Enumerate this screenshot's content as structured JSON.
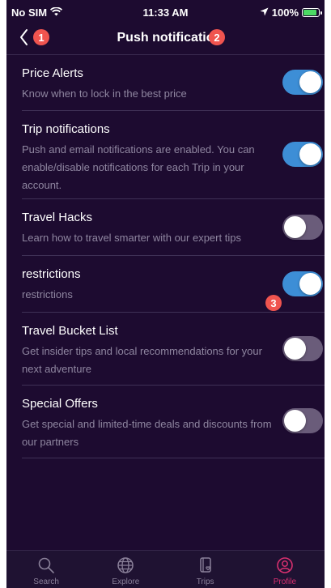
{
  "status_bar": {
    "carrier": "No SIM",
    "time": "11:33 AM",
    "battery": "100%"
  },
  "header": {
    "title": "Push notificatio",
    "back_badge": "1",
    "title_badge": "2"
  },
  "settings": [
    {
      "title": "Price Alerts",
      "description": "Know when to lock in the best price",
      "enabled": true
    },
    {
      "title": "Trip notifications",
      "description": "Push and email notifications are enabled. You can enable/disable notifications for each Trip in your account.",
      "enabled": true
    },
    {
      "title": "Travel Hacks",
      "description": "Learn how to travel smarter with our expert tips",
      "enabled": false
    },
    {
      "title": "restrictions",
      "description": "restrictions",
      "enabled": true,
      "badge": "3"
    },
    {
      "title": "Travel Bucket List",
      "description": "Get insider tips and local recommendations for your next adventure",
      "enabled": false
    },
    {
      "title": "Special Offers",
      "description": "Get special and limited-time deals and discounts from our partners",
      "enabled": false
    }
  ],
  "tab_bar": {
    "tabs": [
      {
        "label": "Search",
        "icon": "search-icon",
        "active": false
      },
      {
        "label": "Explore",
        "icon": "globe-icon",
        "active": false
      },
      {
        "label": "Trips",
        "icon": "trips-icon",
        "active": false
      },
      {
        "label": "Profile",
        "icon": "profile-icon",
        "active": true
      }
    ],
    "active_color": "#d8306f"
  },
  "colors": {
    "background": "#1d0b30",
    "toggle_on": "#3d8ed6",
    "toggle_off": "#6a5c7a",
    "badge": "#f0544f"
  }
}
